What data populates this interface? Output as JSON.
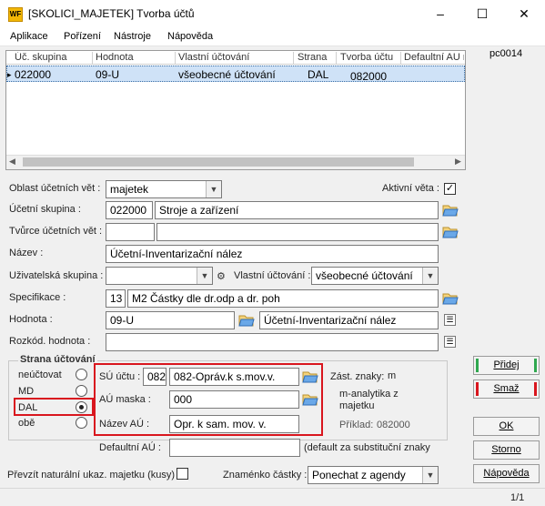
{
  "window": {
    "logo": "WF",
    "title": "[SKOLICI_MAJETEK] Tvorba účtů",
    "minimize_icon": "–",
    "maximize_icon": "☐",
    "close_icon": "✕"
  },
  "menu": [
    "Aplikace",
    "Pořízení",
    "Nástroje",
    "Nápověda"
  ],
  "grid": {
    "columns": [
      "Úč. skupina",
      "Hodnota",
      "Vlastní účtování",
      "Strana",
      "Tvorba účtu",
      "Defaultní AU m"
    ],
    "row": [
      "022000",
      "09-U",
      "všeobecné účtování",
      "DAL",
      "082000",
      ""
    ],
    "row_marker": "▸"
  },
  "side_code": "pc0014",
  "form": {
    "oblast_label": "Oblast účetních vět :",
    "oblast_value": "majetek",
    "aktivni_label": "Aktivní věta :",
    "aktivni_checked": "✓",
    "ucetni_skupina_label": "Účetní skupina :",
    "ucetni_skupina_code": "022000",
    "ucetni_skupina_name": "Stroje a zařízení",
    "tvurce_label": "Tvůrce účetních vět :",
    "tvurce_value": "",
    "tvurce_value2": "",
    "nazev_label": "Název :",
    "nazev_value": "Účetní-Inventarizační nález",
    "uziv_skupina_label": "Uživatelská skupina :",
    "uziv_skupina_value": "",
    "vlastni_label": "Vlastní účtování :",
    "vlastni_value": "všeobecné účtování",
    "specifikace_label": "Specifikace :",
    "specifikace_code": "13",
    "specifikace_value": "M2 Částky dle dr.odp a dr. poh",
    "hodnota_label": "Hodnota :",
    "hodnota_value": "09-U",
    "hodnota_name": "Účetní-Inventarizační nález",
    "rozkod_label": "Rozkód. hodnota :",
    "rozkod_value": ""
  },
  "strana": {
    "title": "Strana účtování",
    "options": [
      "neúčtovat",
      "MD",
      "DAL",
      "obě"
    ],
    "selected": "DAL",
    "su_label": "SÚ účtu :",
    "su_code": "082",
    "su_value": "082-Opráv.k s.mov.v.",
    "au_label": "AÚ maska :",
    "au_value": "000",
    "nazev_au_label": "Název AÚ :",
    "nazev_au_value": "Opr. k sam. mov. v.",
    "zast_label": "Zást. znaky:",
    "zast_value": "m",
    "zast_desc": "m-analytika z majetku",
    "priklad_label": "Příklad:",
    "priklad_value": "082000",
    "default_au_label": "Defaultní AÚ :",
    "default_au_value": "",
    "default_au_note": "(default za substituční znaky"
  },
  "bottom": {
    "prevzit_label": "Převzít naturální ukaz. majetku (kusy)",
    "znamenko_label": "Znaménko částky :",
    "znamenko_value": "Ponechat z agendy"
  },
  "buttons": {
    "pridej": "Přidej",
    "smaz": "Smaž",
    "ok": "OK",
    "storno": "Storno",
    "napoveda": "Nápověda"
  },
  "status": {
    "page": "1/1"
  },
  "colors": {
    "red_highlight": "#d9161e",
    "green_bar": "#2fa84f",
    "selection": "#cfe2f7"
  }
}
